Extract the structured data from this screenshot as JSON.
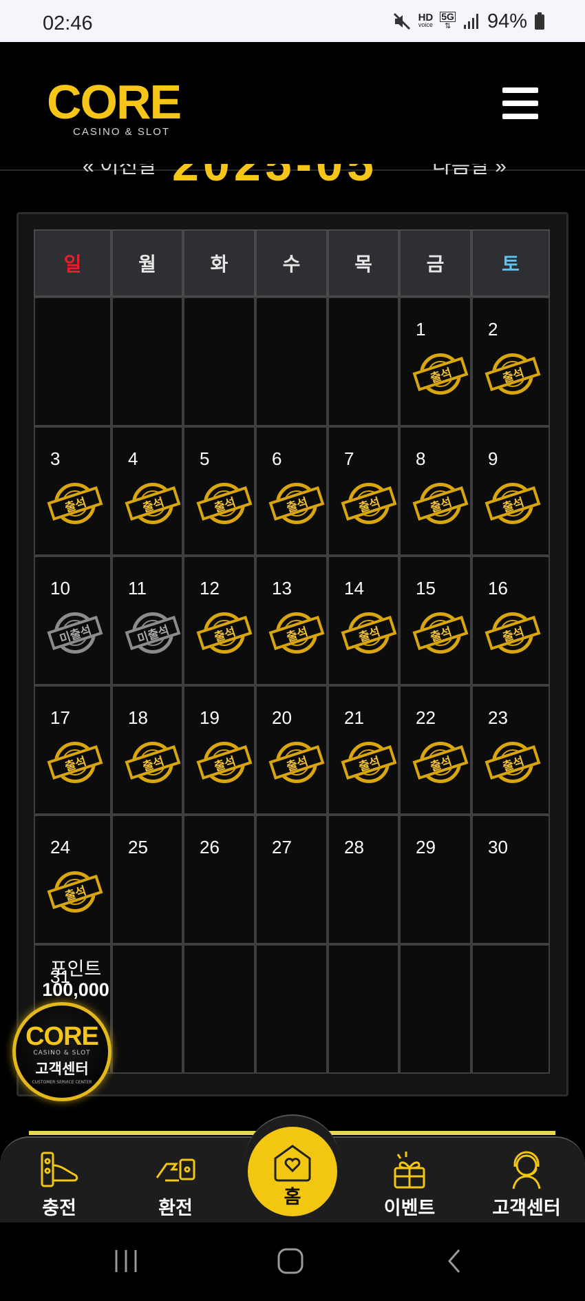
{
  "status": {
    "time": "02:46",
    "battery": "94%",
    "network": "5G",
    "hd_label": "HD",
    "hd_sub": "voice"
  },
  "header": {
    "logo": "CORE",
    "logo_sub": "CASINO & SLOT"
  },
  "month_nav": {
    "prev": "« 이전달",
    "title": "2025-05",
    "next": "다음달 »"
  },
  "calendar": {
    "weekdays": [
      "일",
      "월",
      "화",
      "수",
      "목",
      "금",
      "토"
    ],
    "stamp_present": "출석",
    "stamp_absent": "미출석",
    "days": [
      {
        "n": "",
        "s": ""
      },
      {
        "n": "",
        "s": ""
      },
      {
        "n": "",
        "s": ""
      },
      {
        "n": "",
        "s": ""
      },
      {
        "n": "",
        "s": ""
      },
      {
        "n": "1",
        "s": "present"
      },
      {
        "n": "2",
        "s": "present"
      },
      {
        "n": "3",
        "s": "present"
      },
      {
        "n": "4",
        "s": "present"
      },
      {
        "n": "5",
        "s": "present"
      },
      {
        "n": "6",
        "s": "present"
      },
      {
        "n": "7",
        "s": "present"
      },
      {
        "n": "8",
        "s": "present"
      },
      {
        "n": "9",
        "s": "present"
      },
      {
        "n": "10",
        "s": "absent"
      },
      {
        "n": "11",
        "s": "absent"
      },
      {
        "n": "12",
        "s": "present"
      },
      {
        "n": "13",
        "s": "present"
      },
      {
        "n": "14",
        "s": "present"
      },
      {
        "n": "15",
        "s": "present"
      },
      {
        "n": "16",
        "s": "present"
      },
      {
        "n": "17",
        "s": "present"
      },
      {
        "n": "18",
        "s": "present"
      },
      {
        "n": "19",
        "s": "present"
      },
      {
        "n": "20",
        "s": "present"
      },
      {
        "n": "21",
        "s": "present"
      },
      {
        "n": "22",
        "s": "present"
      },
      {
        "n": "23",
        "s": "present"
      },
      {
        "n": "24",
        "s": "present"
      },
      {
        "n": "25",
        "s": ""
      },
      {
        "n": "26",
        "s": ""
      },
      {
        "n": "27",
        "s": ""
      },
      {
        "n": "28",
        "s": ""
      },
      {
        "n": "29",
        "s": ""
      },
      {
        "n": "30",
        "s": ""
      },
      {
        "n": "31",
        "s": ""
      },
      {
        "n": "",
        "s": ""
      },
      {
        "n": "",
        "s": ""
      },
      {
        "n": "",
        "s": ""
      },
      {
        "n": "",
        "s": ""
      },
      {
        "n": "",
        "s": ""
      },
      {
        "n": "",
        "s": ""
      }
    ]
  },
  "points": {
    "label": "포인트",
    "value": "100,000"
  },
  "support_badge": {
    "logo": "CORE",
    "sub": "CASINO & SLOT",
    "title": "고객센터",
    "sub2": "CUSTOMER SERVICE CENTER"
  },
  "bottom_nav": {
    "deposit": "충전",
    "withdraw": "환전",
    "home": "홈",
    "event": "이벤트",
    "support": "고객센터"
  },
  "colors": {
    "accent": "#f2c611",
    "sunday": "#e3202b",
    "saturday": "#5cc3f0"
  }
}
